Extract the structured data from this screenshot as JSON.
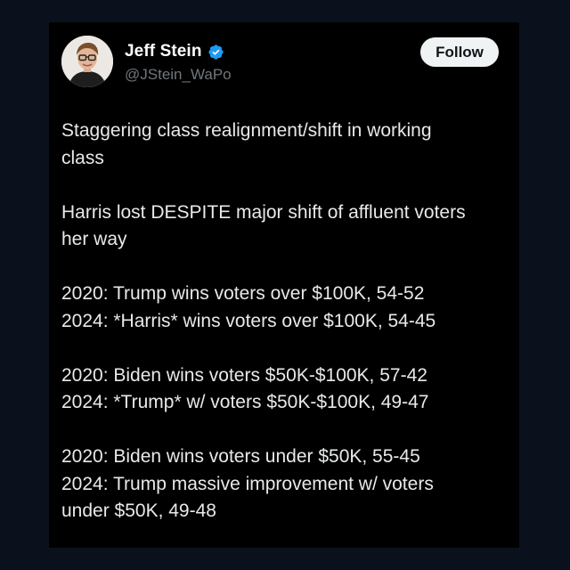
{
  "author": {
    "name": "Jeff Stein",
    "handle": "@JStein_WaPo",
    "verified_badge_icon": "verified-check-icon",
    "verified_color": "#1d9bf0"
  },
  "follow_button": {
    "label": "Follow"
  },
  "tweet": {
    "paragraphs": [
      {
        "lines": [
          "Staggering class realignment/shift in working",
          "class"
        ]
      },
      {
        "lines": [
          "Harris lost DESPITE major shift of affluent voters",
          "her way"
        ]
      },
      {
        "lines": [
          "2020: Trump wins voters over $100K, 54-52",
          "2024: *Harris* wins voters over $100K, 54-45"
        ]
      },
      {
        "lines": [
          "2020: Biden wins voters $50K-$100K, 57-42",
          "2024: *Trump* w/ voters $50K-$100K, 49-47"
        ]
      },
      {
        "lines": [
          "2020: Biden wins voters under $50K, 55-45",
          "2024: Trump massive improvement w/ voters",
          "under $50K, 49-48"
        ]
      }
    ]
  },
  "colors": {
    "page_background": "#0b111c",
    "card_background": "#000000",
    "text_primary": "#e7e9ea",
    "text_secondary": "#71767b",
    "button_background": "#eff3f4"
  }
}
